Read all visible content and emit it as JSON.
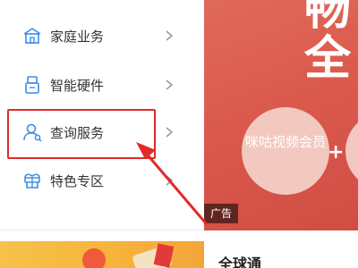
{
  "menu": {
    "items": [
      {
        "label": "家庭业务",
        "icon": "house-icon"
      },
      {
        "label": "智能硬件",
        "icon": "device-icon"
      },
      {
        "label": "查询服务",
        "icon": "user-search-icon"
      },
      {
        "label": "特色专区",
        "icon": "gift-icon"
      }
    ],
    "highlighted_index": 2
  },
  "banner": {
    "headline_line1": "畅",
    "headline_line2": "全",
    "bubble_text": "咪咕视频会员",
    "plus": "+",
    "ad_tag": "广告"
  },
  "bottom": {
    "title": "全球通"
  },
  "colors": {
    "icon_blue": "#3a8ee6",
    "annotation_red": "#e02b2b",
    "banner_red": "#d9574b"
  }
}
